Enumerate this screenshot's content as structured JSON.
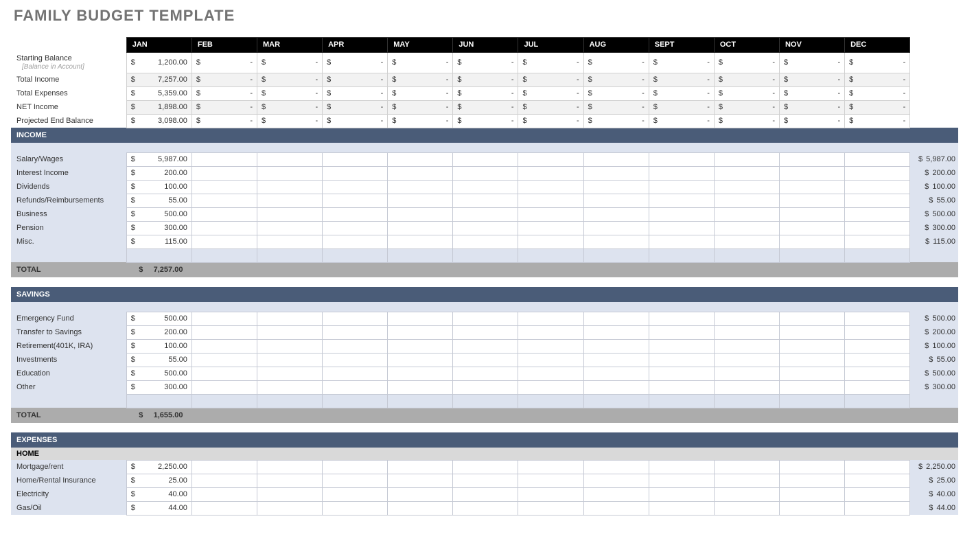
{
  "title": "FAMILY BUDGET TEMPLATE",
  "months": [
    "JAN",
    "FEB",
    "MAR",
    "APR",
    "MAY",
    "JUN",
    "JUL",
    "AUG",
    "SEPT",
    "OCT",
    "NOV",
    "DEC"
  ],
  "summary": {
    "rows": [
      {
        "label": "Starting Balance",
        "sublabel": "[Balance in Account]",
        "jan": "1,200.00"
      },
      {
        "label": "Total Income",
        "jan": "7,257.00",
        "shade": true
      },
      {
        "label": "Total Expenses",
        "jan": "5,359.00"
      },
      {
        "label": "NET Income",
        "jan": "1,898.00",
        "shade": true
      },
      {
        "label": "Projected End Balance",
        "jan": "3,098.00"
      }
    ]
  },
  "income": {
    "heading": "INCOME",
    "rows": [
      {
        "label": "Salary/Wages",
        "jan": "5,987.00",
        "total": "5,987.00"
      },
      {
        "label": "Interest Income",
        "jan": "200.00",
        "total": "200.00"
      },
      {
        "label": "Dividends",
        "jan": "100.00",
        "total": "100.00"
      },
      {
        "label": "Refunds/Reimbursements",
        "jan": "55.00",
        "total": "55.00"
      },
      {
        "label": "Business",
        "jan": "500.00",
        "total": "500.00"
      },
      {
        "label": "Pension",
        "jan": "300.00",
        "total": "300.00"
      },
      {
        "label": "Misc.",
        "jan": "115.00",
        "total": "115.00"
      }
    ],
    "total_label": "TOTAL",
    "total": "7,257.00"
  },
  "savings": {
    "heading": "SAVINGS",
    "rows": [
      {
        "label": "Emergency Fund",
        "jan": "500.00",
        "total": "500.00"
      },
      {
        "label": "Transfer to Savings",
        "jan": "200.00",
        "total": "200.00"
      },
      {
        "label": "Retirement(401K, IRA)",
        "jan": "100.00",
        "total": "100.00"
      },
      {
        "label": "Investments",
        "jan": "55.00",
        "total": "55.00"
      },
      {
        "label": "Education",
        "jan": "500.00",
        "total": "500.00"
      },
      {
        "label": "Other",
        "jan": "300.00",
        "total": "300.00"
      }
    ],
    "total_label": "TOTAL",
    "total": "1,655.00"
  },
  "expenses": {
    "heading": "EXPENSES",
    "subheading": "HOME",
    "rows": [
      {
        "label": "Mortgage/rent",
        "jan": "2,250.00",
        "total": "2,250.00"
      },
      {
        "label": "Home/Rental Insurance",
        "jan": "25.00",
        "total": "25.00"
      },
      {
        "label": "Electricity",
        "jan": "40.00",
        "total": "40.00"
      },
      {
        "label": "Gas/Oil",
        "jan": "44.00",
        "total": "44.00"
      }
    ]
  }
}
